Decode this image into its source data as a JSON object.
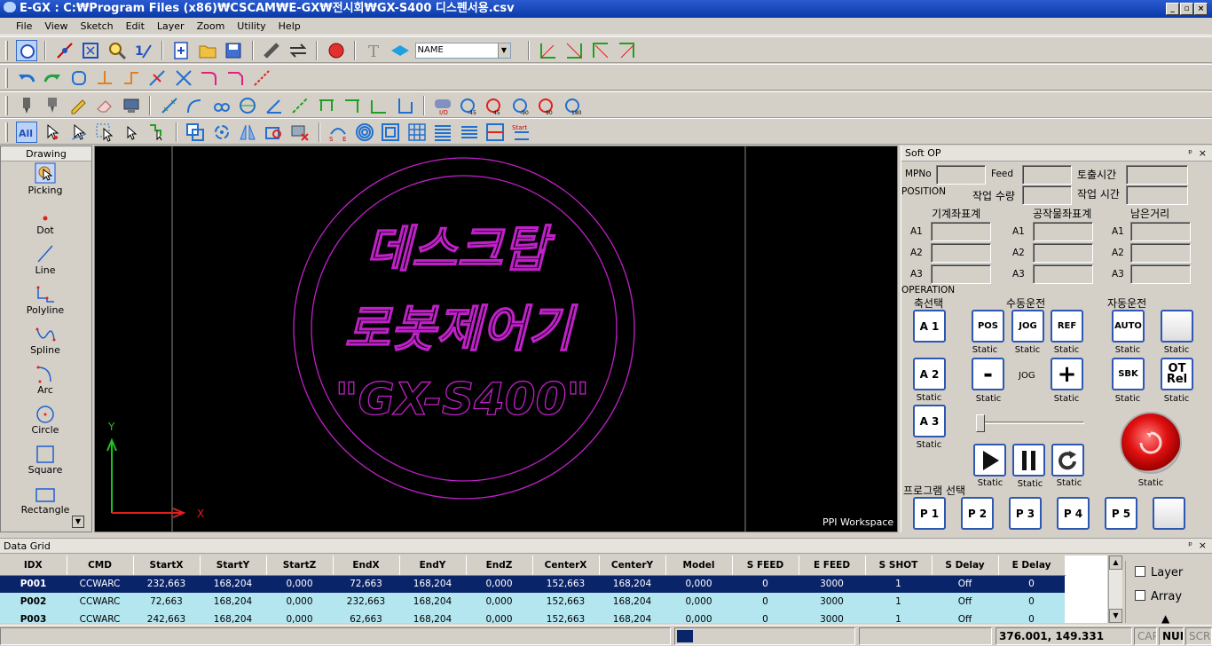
{
  "window": {
    "title": "E-GX : C:₩Program Files (x86)₩CSCAM₩E-GX₩전시회₩GX-S400 디스펜서용.csv"
  },
  "menu": [
    "File",
    "View",
    "Sketch",
    "Edit",
    "Layer",
    "Zoom",
    "Utility",
    "Help"
  ],
  "toolbar": {
    "name_select": "NAME"
  },
  "drawing_panel": {
    "title": "Drawing",
    "tools": [
      {
        "label": "Picking",
        "icon": "picking-icon"
      },
      {
        "label": "Dot",
        "icon": "dot-icon"
      },
      {
        "label": "Line",
        "icon": "line-icon"
      },
      {
        "label": "Polyline",
        "icon": "polyline-icon"
      },
      {
        "label": "Spline",
        "icon": "spline-icon"
      },
      {
        "label": "Arc",
        "icon": "arc-icon"
      },
      {
        "label": "Circle",
        "icon": "circle-icon"
      },
      {
        "label": "Square",
        "icon": "square-icon"
      },
      {
        "label": "Rectangle",
        "icon": "rectangle-icon"
      }
    ]
  },
  "canvas": {
    "text_line1": "데스크탑",
    "text_line2": "로봇제어기",
    "text_line3": "\"GX-S400\"",
    "axis_x": "X",
    "axis_y": "Y",
    "workspace_label": "PPI Workspace",
    "colors": {
      "shape": "#c020c8",
      "x_axis": "#e02020",
      "y_axis": "#20c020"
    }
  },
  "soft_op": {
    "title": "Soft OP",
    "mpno_label": "MPNo",
    "feed_label": "Feed",
    "discharge_time_label": "토출시간",
    "position_label": "POSITION",
    "work_qty_label": "작업 수량",
    "work_time_label": "작업 시간",
    "machine_coord_label": "기계좌표계",
    "work_coord_label": "공작물좌표계",
    "remaining_label": "남은거리",
    "axes": [
      "A1",
      "A2",
      "A3"
    ],
    "operation_label": "OPERATION",
    "axis_select_label": "축선택",
    "manual_label": "수동운전",
    "auto_label": "자동운전",
    "jog_label": "JOG",
    "program_select_label": "프로그램 선택",
    "static": "Static",
    "buttons": {
      "a1": "A 1",
      "a2": "A 2",
      "a3": "A 3",
      "pos": "POS",
      "jog": "JOG",
      "ref": "REF",
      "auto": "AUTO",
      "minus": "-",
      "plus": "+",
      "sbk": "SBK",
      "ot_rel_1": "OT",
      "ot_rel_2": "Rel",
      "programs": [
        "P 1",
        "P 2",
        "P 3",
        "P 4",
        "P 5"
      ]
    }
  },
  "data_grid": {
    "title": "Data Grid",
    "columns": [
      "IDX",
      "CMD",
      "StartX",
      "StartY",
      "StartZ",
      "EndX",
      "EndY",
      "EndZ",
      "CenterX",
      "CenterY",
      "Model",
      "S FEED",
      "E FEED",
      "S SHOT",
      "S Delay",
      "E Delay"
    ],
    "rows": [
      [
        "P001",
        "CCWARC",
        "232,663",
        "168,204",
        "0,000",
        "72,663",
        "168,204",
        "0,000",
        "152,663",
        "168,204",
        "0,000",
        "0",
        "3000",
        "1",
        "Off",
        "0"
      ],
      [
        "P002",
        "CCWARC",
        "72,663",
        "168,204",
        "0,000",
        "232,663",
        "168,204",
        "0,000",
        "152,663",
        "168,204",
        "0,000",
        "0",
        "3000",
        "1",
        "Off",
        "0"
      ],
      [
        "P003",
        "CCWARC",
        "242,663",
        "168,204",
        "0,000",
        "62,663",
        "168,204",
        "0,000",
        "152,663",
        "168,204",
        "0,000",
        "0",
        "3000",
        "1",
        "Off",
        "0"
      ]
    ],
    "layer_label": "Layer",
    "array_label": "Array"
  },
  "status_bar": {
    "coords": "376.001, 149.331",
    "caps": "CAP",
    "num": "NUM",
    "scrl": "SCRL"
  }
}
